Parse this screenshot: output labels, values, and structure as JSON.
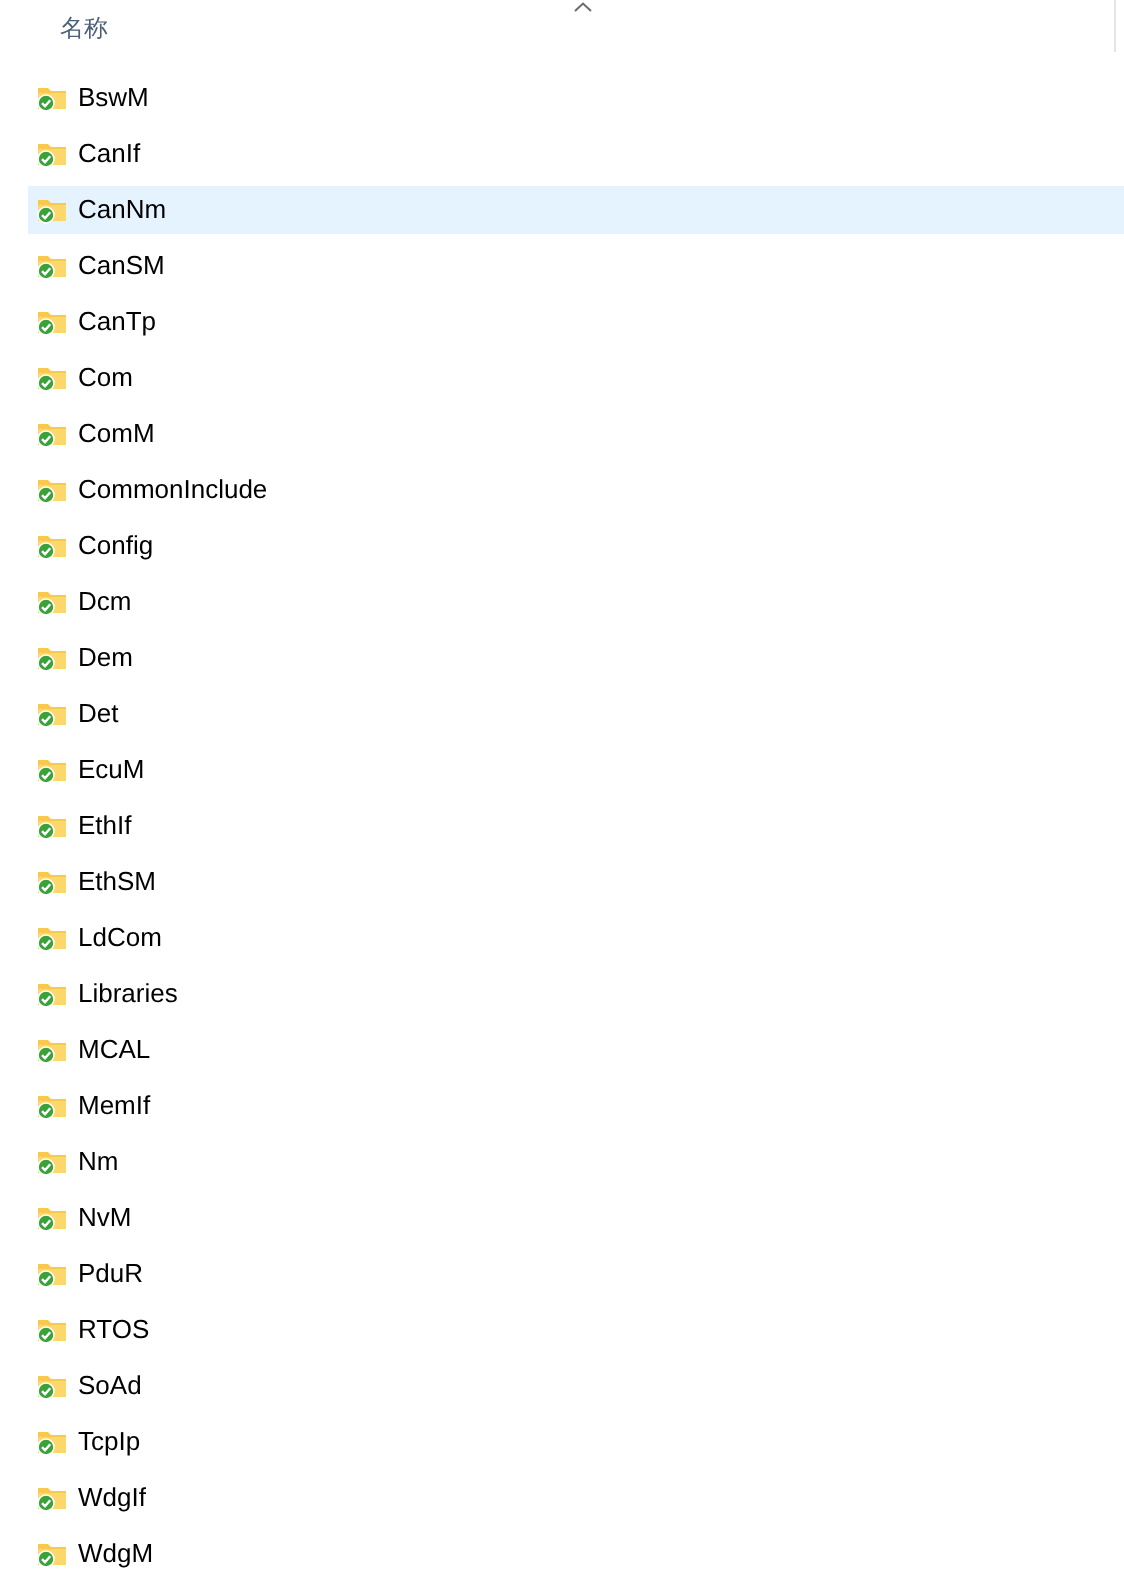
{
  "header": {
    "column": "名称"
  },
  "items": [
    {
      "name": "BswM",
      "selected": false
    },
    {
      "name": "CanIf",
      "selected": false
    },
    {
      "name": "CanNm",
      "selected": true
    },
    {
      "name": "CanSM",
      "selected": false
    },
    {
      "name": "CanTp",
      "selected": false
    },
    {
      "name": "Com",
      "selected": false
    },
    {
      "name": "ComM",
      "selected": false
    },
    {
      "name": "CommonInclude",
      "selected": false
    },
    {
      "name": "Config",
      "selected": false
    },
    {
      "name": "Dcm",
      "selected": false
    },
    {
      "name": "Dem",
      "selected": false
    },
    {
      "name": "Det",
      "selected": false
    },
    {
      "name": "EcuM",
      "selected": false
    },
    {
      "name": "EthIf",
      "selected": false
    },
    {
      "name": "EthSM",
      "selected": false
    },
    {
      "name": "LdCom",
      "selected": false
    },
    {
      "name": "Libraries",
      "selected": false
    },
    {
      "name": "MCAL",
      "selected": false
    },
    {
      "name": "MemIf",
      "selected": false
    },
    {
      "name": "Nm",
      "selected": false
    },
    {
      "name": "NvM",
      "selected": false
    },
    {
      "name": "PduR",
      "selected": false
    },
    {
      "name": "RTOS",
      "selected": false
    },
    {
      "name": "SoAd",
      "selected": false
    },
    {
      "name": "TcpIp",
      "selected": false
    },
    {
      "name": "WdgIf",
      "selected": false
    },
    {
      "name": "WdgM",
      "selected": false
    }
  ]
}
